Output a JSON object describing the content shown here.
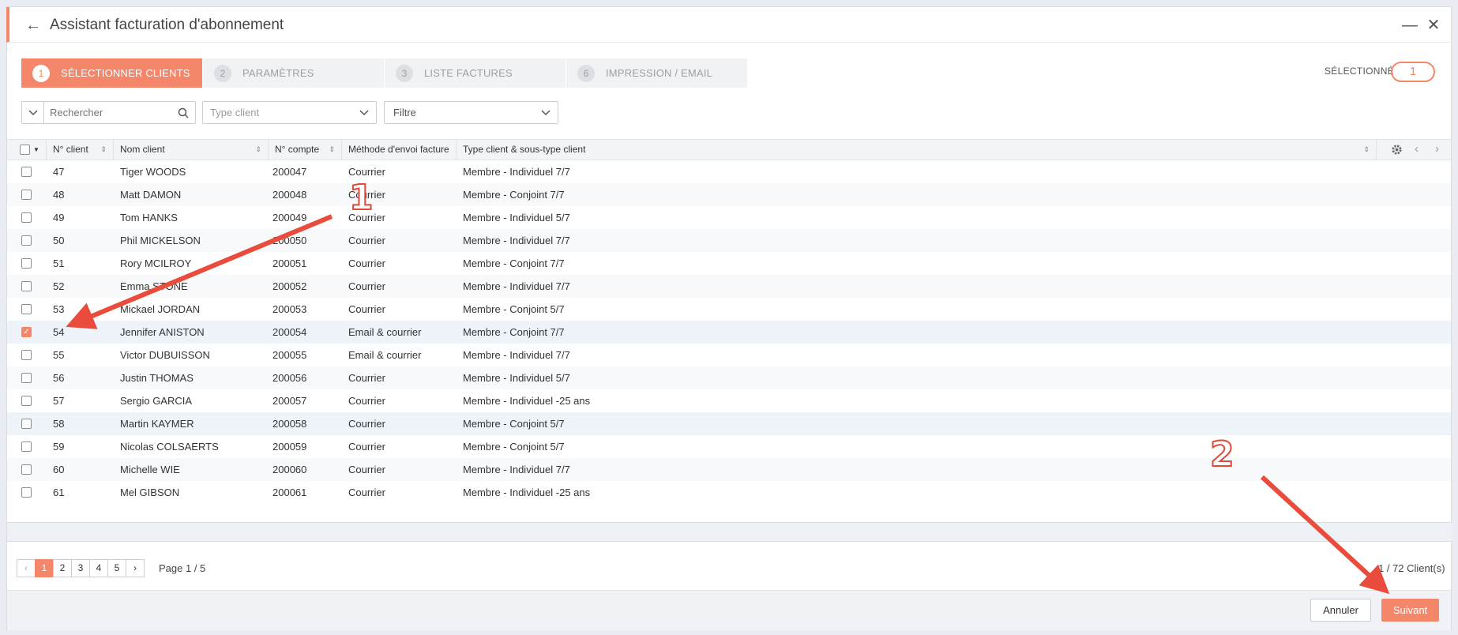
{
  "window": {
    "title": "Assistant facturation d'abonnement",
    "back_icon": "←",
    "min_icon": "—",
    "close_icon": "✕"
  },
  "steps": [
    {
      "num": "1",
      "label": "SÉLECTIONNER CLIENTS",
      "active": true
    },
    {
      "num": "2",
      "label": "PARAMÈTRES"
    },
    {
      "num": "3",
      "label": "LISTE FACTURES"
    },
    {
      "num": "6",
      "label": "IMPRESSION / EMAIL"
    }
  ],
  "selection": {
    "label": "SÉLECTIONNÉ",
    "count": "1"
  },
  "filters": {
    "search_placeholder": "Rechercher",
    "type_placeholder": "Type client",
    "filter_placeholder": "Filtre"
  },
  "columns": {
    "num": "N° client",
    "name": "Nom client",
    "account": "N° compte",
    "method": "Méthode d'envoi facture",
    "type": "Type client & sous-type client"
  },
  "rows": [
    {
      "num": "47",
      "name": "Tiger WOODS",
      "account": "200047",
      "method": "Courrier",
      "type": "Membre - Individuel 7/7"
    },
    {
      "num": "48",
      "name": "Matt DAMON",
      "account": "200048",
      "method": "Courrier",
      "type": "Membre - Conjoint 7/7"
    },
    {
      "num": "49",
      "name": "Tom HANKS",
      "account": "200049",
      "method": "Courrier",
      "type": "Membre - Individuel 5/7"
    },
    {
      "num": "50",
      "name": "Phil MICKELSON",
      "account": "200050",
      "method": "Courrier",
      "type": "Membre - Individuel 7/7"
    },
    {
      "num": "51",
      "name": "Rory MCILROY",
      "account": "200051",
      "method": "Courrier",
      "type": "Membre - Conjoint 7/7"
    },
    {
      "num": "52",
      "name": "Emma STONE",
      "account": "200052",
      "method": "Courrier",
      "type": "Membre - Individuel 7/7"
    },
    {
      "num": "53",
      "name": "Mickael JORDAN",
      "account": "200053",
      "method": "Courrier",
      "type": "Membre - Conjoint 5/7"
    },
    {
      "num": "54",
      "name": "Jennifer ANISTON",
      "account": "200054",
      "method": "Email & courrier",
      "type": "Membre - Conjoint 7/7",
      "checked": true
    },
    {
      "num": "55",
      "name": "Victor DUBUISSON",
      "account": "200055",
      "method": "Email & courrier",
      "type": "Membre - Individuel 7/7"
    },
    {
      "num": "56",
      "name": "Justin THOMAS",
      "account": "200056",
      "method": "Courrier",
      "type": "Membre - Individuel 5/7"
    },
    {
      "num": "57",
      "name": "Sergio GARCIA",
      "account": "200057",
      "method": "Courrier",
      "type": "Membre - Individuel -25 ans"
    },
    {
      "num": "58",
      "name": "Martin KAYMER",
      "account": "200058",
      "method": "Courrier",
      "type": "Membre - Conjoint 5/7"
    },
    {
      "num": "59",
      "name": "Nicolas COLSAERTS",
      "account": "200059",
      "method": "Courrier",
      "type": "Membre - Conjoint 5/7"
    },
    {
      "num": "60",
      "name": "Michelle WIE",
      "account": "200060",
      "method": "Courrier",
      "type": "Membre - Individuel 7/7"
    },
    {
      "num": "61",
      "name": "Mel GIBSON",
      "account": "200061",
      "method": "Courrier",
      "type": "Membre - Individuel -25 ans"
    }
  ],
  "pager": {
    "pages": [
      "1",
      "2",
      "3",
      "4",
      "5"
    ],
    "prev": "‹",
    "next": "›",
    "info": "Page 1 / 5",
    "count": "1 / 72 Client(s)"
  },
  "buttons": {
    "cancel": "Annuler",
    "next": "Suivant"
  },
  "annotations": {
    "one": "1",
    "two": "2"
  },
  "colors": {
    "accent": "#f4876a",
    "annotation": "#e04a3a"
  }
}
